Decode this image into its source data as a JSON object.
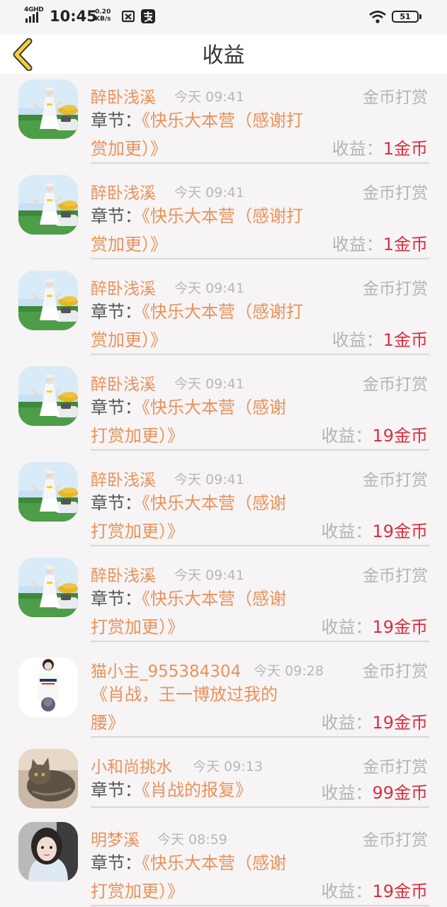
{
  "status_bar": {
    "network": "4GHD",
    "time": "10:45",
    "speed_value": "0.20",
    "speed_unit": "KB/s",
    "battery": "51",
    "icons": [
      "signal-icon",
      "app-notify-icon",
      "alipay-icon",
      "wifi-icon",
      "battery-icon"
    ]
  },
  "header": {
    "title": "收益",
    "back_icon": "chevron-left-icon",
    "accent_color": "#f2d23a"
  },
  "colors": {
    "name": "#e8935b",
    "earning_value": "#d8303f",
    "muted": "#b5b3b3"
  },
  "items": [
    {
      "name": "醉卧浅溪",
      "time": "今天 09:41",
      "type": "金币打赏",
      "chapter_label": "章节：",
      "chapter_line1": "《快乐大本营（感谢打",
      "chapter_line2": "赏加更）》",
      "earn_label": "收益：",
      "earn_value": "1金币",
      "avatar": "girl-field"
    },
    {
      "name": "醉卧浅溪",
      "time": "今天 09:41",
      "type": "金币打赏",
      "chapter_label": "章节：",
      "chapter_line1": "《快乐大本营（感谢打",
      "chapter_line2": "赏加更）》",
      "earn_label": "收益：",
      "earn_value": "1金币",
      "avatar": "girl-field"
    },
    {
      "name": "醉卧浅溪",
      "time": "今天 09:41",
      "type": "金币打赏",
      "chapter_label": "章节：",
      "chapter_line1": "《快乐大本营（感谢打",
      "chapter_line2": "赏加更）》",
      "earn_label": "收益：",
      "earn_value": "1金币",
      "avatar": "girl-field"
    },
    {
      "name": "醉卧浅溪",
      "time": "今天 09:41",
      "type": "金币打赏",
      "chapter_label": "章节：",
      "chapter_line1": "《快乐大本营（感谢",
      "chapter_line2": "打赏加更）》",
      "earn_label": "收益：",
      "earn_value": "19金币",
      "avatar": "girl-field"
    },
    {
      "name": "醉卧浅溪",
      "time": "今天 09:41",
      "type": "金币打赏",
      "chapter_label": "章节：",
      "chapter_line1": "《快乐大本营（感谢",
      "chapter_line2": "打赏加更）》",
      "earn_label": "收益：",
      "earn_value": "19金币",
      "avatar": "girl-field"
    },
    {
      "name": "醉卧浅溪",
      "time": "今天 09:41",
      "type": "金币打赏",
      "chapter_label": "章节：",
      "chapter_line1": "《快乐大本营（感谢",
      "chapter_line2": "打赏加更）》",
      "earn_label": "收益：",
      "earn_value": "19金币",
      "avatar": "girl-field"
    },
    {
      "name": "猫小主_955384304",
      "time": "今天 09:28",
      "type": "金币打赏",
      "chapter_label": "",
      "chapter_line1": "《肖战，王一博放过我的",
      "chapter_line2": "腰》",
      "earn_label": "收益：",
      "earn_value": "19金币",
      "avatar": "girl-shirt"
    },
    {
      "name": "小和尚挑水",
      "time": "今天 09:13",
      "type": "金币打赏",
      "chapter_label": "章节：",
      "chapter_line1": "《肖战的报复》",
      "chapter_line2": "",
      "earn_label": "收益：",
      "earn_value": "99金币",
      "avatar": "cat"
    },
    {
      "name": "明梦溪",
      "time": "今天 08:59",
      "type": "金币打赏",
      "chapter_label": "章节：",
      "chapter_line1": "《快乐大本营（感谢",
      "chapter_line2": "打赏加更）》",
      "earn_label": "收益：",
      "earn_value": "19金币",
      "avatar": "girl-portrait"
    }
  ]
}
